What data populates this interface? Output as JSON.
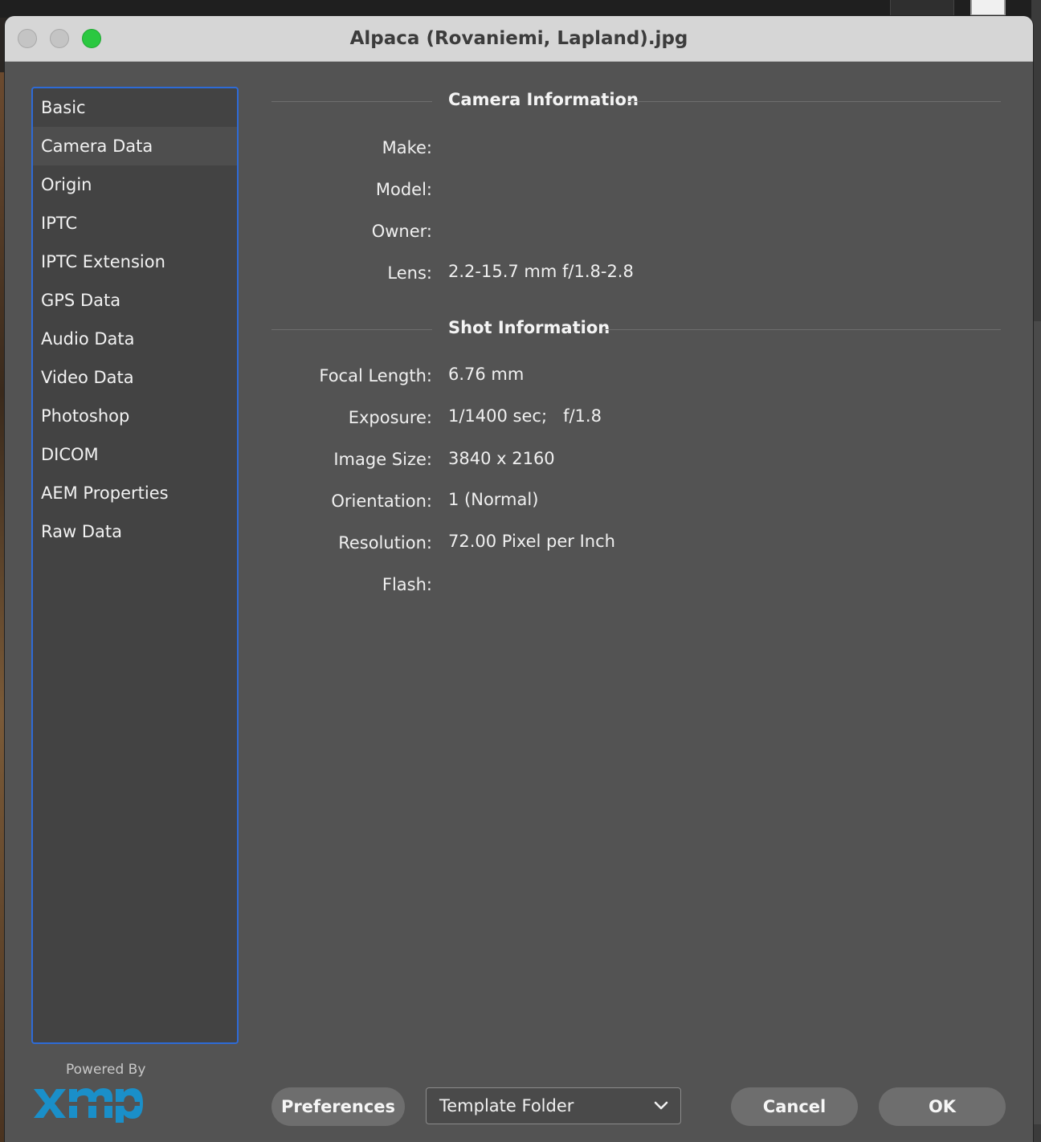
{
  "window": {
    "title": "Alpaca (Rovaniemi, Lapland).jpg"
  },
  "sidebar": {
    "items": [
      {
        "label": "Basic"
      },
      {
        "label": "Camera Data"
      },
      {
        "label": "Origin"
      },
      {
        "label": "IPTC"
      },
      {
        "label": "IPTC Extension"
      },
      {
        "label": "GPS Data"
      },
      {
        "label": "Audio Data"
      },
      {
        "label": "Video Data"
      },
      {
        "label": "Photoshop"
      },
      {
        "label": "DICOM"
      },
      {
        "label": "AEM Properties"
      },
      {
        "label": "Raw Data"
      }
    ],
    "selected": "Camera Data"
  },
  "branding": {
    "powered_by": "Powered By",
    "logo": "xmp"
  },
  "camera_info": {
    "title": "Camera Information",
    "fields": [
      {
        "label": "Make:",
        "value": ""
      },
      {
        "label": "Model:",
        "value": ""
      },
      {
        "label": "Owner:",
        "value": ""
      },
      {
        "label": "Lens:",
        "value": "2.2-15.7 mm f/1.8-2.8"
      }
    ]
  },
  "shot_info": {
    "title": "Shot Information",
    "fields": [
      {
        "label": "Focal Length:",
        "value": "6.76 mm"
      },
      {
        "label": "Exposure:",
        "value": "1/1400 sec;   f/1.8"
      },
      {
        "label": "Image Size:",
        "value": "3840 x 2160"
      },
      {
        "label": "Orientation:",
        "value": "1 (Normal)"
      },
      {
        "label": "Resolution:",
        "value": "72.00 Pixel per Inch"
      },
      {
        "label": "Flash:",
        "value": ""
      }
    ]
  },
  "footer": {
    "preferences_label": "Preferences",
    "template_select_value": "Template Folder",
    "cancel_label": "Cancel",
    "ok_label": "OK"
  },
  "colors": {
    "window_bg": "#535353",
    "sidebar_bg": "#434343",
    "focus_ring": "#2e6bd6",
    "zoom_button": "#2ac840",
    "xmp_logo": "#1a8fc9"
  }
}
